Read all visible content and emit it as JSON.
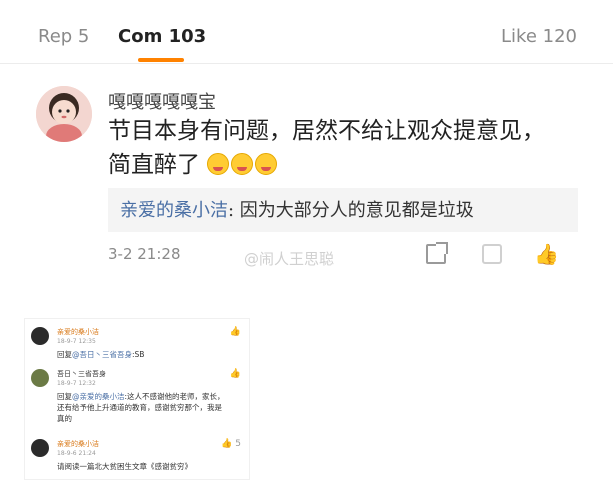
{
  "tabs": {
    "reposts": "Rep 5",
    "comments": "Com 103",
    "likes": "Like 120"
  },
  "comment": {
    "username": "嘎嘎嘎嘎嘎宝",
    "text_line1": "节目本身有问题，居然不给让观众提意见，",
    "text_line2": "简直醉了",
    "reply_user": "亲爱的桑小洁",
    "reply_sep": ": ",
    "reply_text": "因为大部分人的意见都是垃圾",
    "time": "3-2 21:28",
    "watermark": "@闹人王思聪"
  },
  "screenshot": {
    "items": [
      {
        "name": "亲爱的桑小洁",
        "time": "18-9-7 12:35",
        "prefix": "回复",
        "mention": "@吾日丶三省吾身",
        "body": ":SB"
      },
      {
        "name": "吾日丶三省吾身",
        "time": "18-9-7 12:32",
        "prefix": "回复",
        "mention": "@亲爱的桑小洁",
        "body": ":这人不感谢他的老师，家长，还有给予他上升通道的教育，感谢贫穷那个，我是真的"
      },
      {
        "name": "亲爱的桑小洁",
        "time": "18-9-6 21:24",
        "prefix": "",
        "mention": "",
        "body": "请阅读一篇北大贫困生文章《感谢贫穷》",
        "likes": "5"
      }
    ]
  },
  "icons": [
    "share-icon",
    "comment-icon",
    "like-icon",
    "emoji-icon"
  ],
  "colors": {
    "accent": "#ff8200",
    "link": "#4a6fa5",
    "text": "#222222",
    "muted": "#8a8a8a"
  }
}
